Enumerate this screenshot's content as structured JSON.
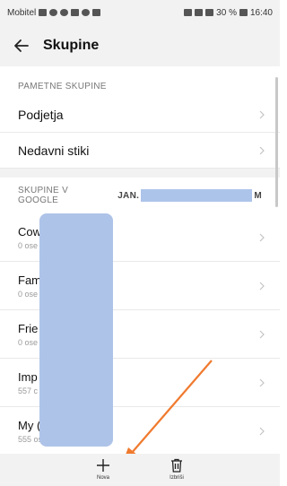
{
  "status_bar": {
    "carrier": "Mobitel",
    "battery": "30 %",
    "time": "16:40"
  },
  "app_bar": {
    "title": "Skupine"
  },
  "smart_groups": {
    "header": "PAMETNE SKUPINE",
    "items": [
      {
        "label": "Podjetja"
      },
      {
        "label": "Nedavni stiki"
      }
    ]
  },
  "google_groups": {
    "header": "SKUPINE V GOOGLE",
    "account_prefix": "JAN.",
    "account_suffix": "M",
    "items": [
      {
        "label": "Cow",
        "sub": "0 ose"
      },
      {
        "label": "Fam",
        "sub": "0 ose"
      },
      {
        "label": "Frie",
        "sub": "0 ose"
      },
      {
        "label": "Imp",
        "sub": "557 c"
      },
      {
        "label": "My (",
        "sub": "555 oseb"
      }
    ]
  },
  "bottom_bar": {
    "new_label": "Nova",
    "delete_label": "Izbriši"
  },
  "colors": {
    "annotation_arrow": "#f07a2e",
    "redaction": "#aec3e8"
  }
}
